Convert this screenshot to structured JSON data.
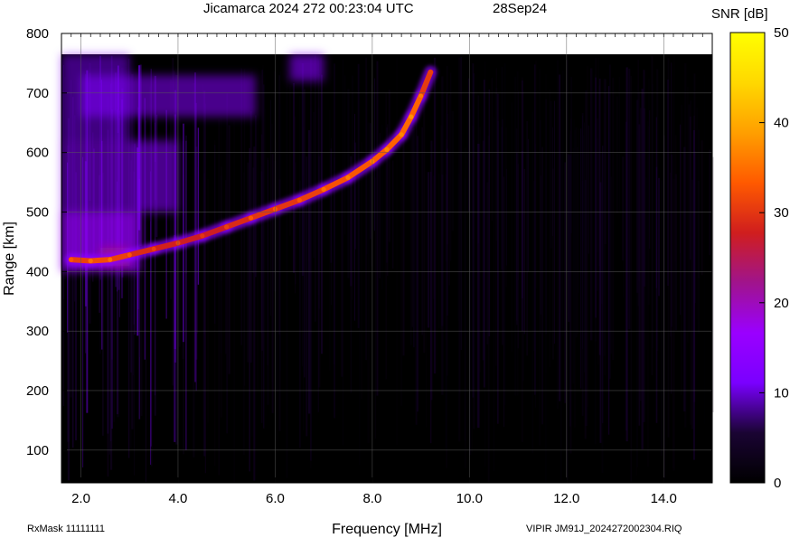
{
  "header": {
    "title": "Jicamarca 2024 272 00:23:04 UTC",
    "date": "28Sep24"
  },
  "footer": {
    "rxmask": "RxMask 11111111",
    "file": "VIPIR  JM91J_2024272002304.RIQ"
  },
  "chart_data": {
    "type": "heatmap",
    "title": "Jicamarca 2024 272 00:23:04 UTC",
    "xlabel": "Frequency [MHz]",
    "ylabel": "Range [km]",
    "xlim": [
      1.6,
      15.0
    ],
    "ylim": [
      45,
      800
    ],
    "data_range_max_km": 765,
    "x_ticks": [
      "2.0",
      "4.0",
      "6.0",
      "8.0",
      "10.0",
      "12.0",
      "14.0"
    ],
    "x_tick_values": [
      2,
      4,
      6,
      8,
      10,
      12,
      14
    ],
    "y_ticks": [
      "100",
      "200",
      "300",
      "400",
      "500",
      "600",
      "700",
      "800"
    ],
    "y_tick_values": [
      100,
      200,
      300,
      400,
      500,
      600,
      700,
      800
    ],
    "grid": true,
    "colorbar": {
      "label": "SNR [dB]",
      "range": [
        0,
        50
      ],
      "ticks": [
        "0",
        "10",
        "20",
        "30",
        "40",
        "50"
      ],
      "tick_values": [
        0,
        10,
        20,
        30,
        40,
        50
      ],
      "colors": [
        "#000000",
        "#1a0433",
        "#7a00ff",
        "#9a00ff",
        "#a0148c",
        "#d01e1e",
        "#ff5a00",
        "#ff9f00",
        "#ffd800",
        "#ffff00"
      ]
    },
    "traces": [
      {
        "name": "trace",
        "x": [
          1.8,
          2.2,
          2.6,
          3.0,
          3.5,
          4.0,
          4.5,
          5.0,
          5.5,
          6.0,
          6.5,
          7.0,
          7.5,
          8.0,
          8.3,
          8.6,
          8.8,
          9.0,
          9.2
        ],
        "y": [
          420,
          418,
          420,
          428,
          438,
          448,
          460,
          475,
          490,
          505,
          520,
          538,
          558,
          585,
          605,
          630,
          660,
          695,
          735
        ],
        "snr": [
          30,
          32,
          32,
          30,
          28,
          28,
          27,
          28,
          30,
          30,
          30,
          32,
          33,
          33,
          34,
          34,
          35,
          33,
          28
        ]
      }
    ]
  }
}
